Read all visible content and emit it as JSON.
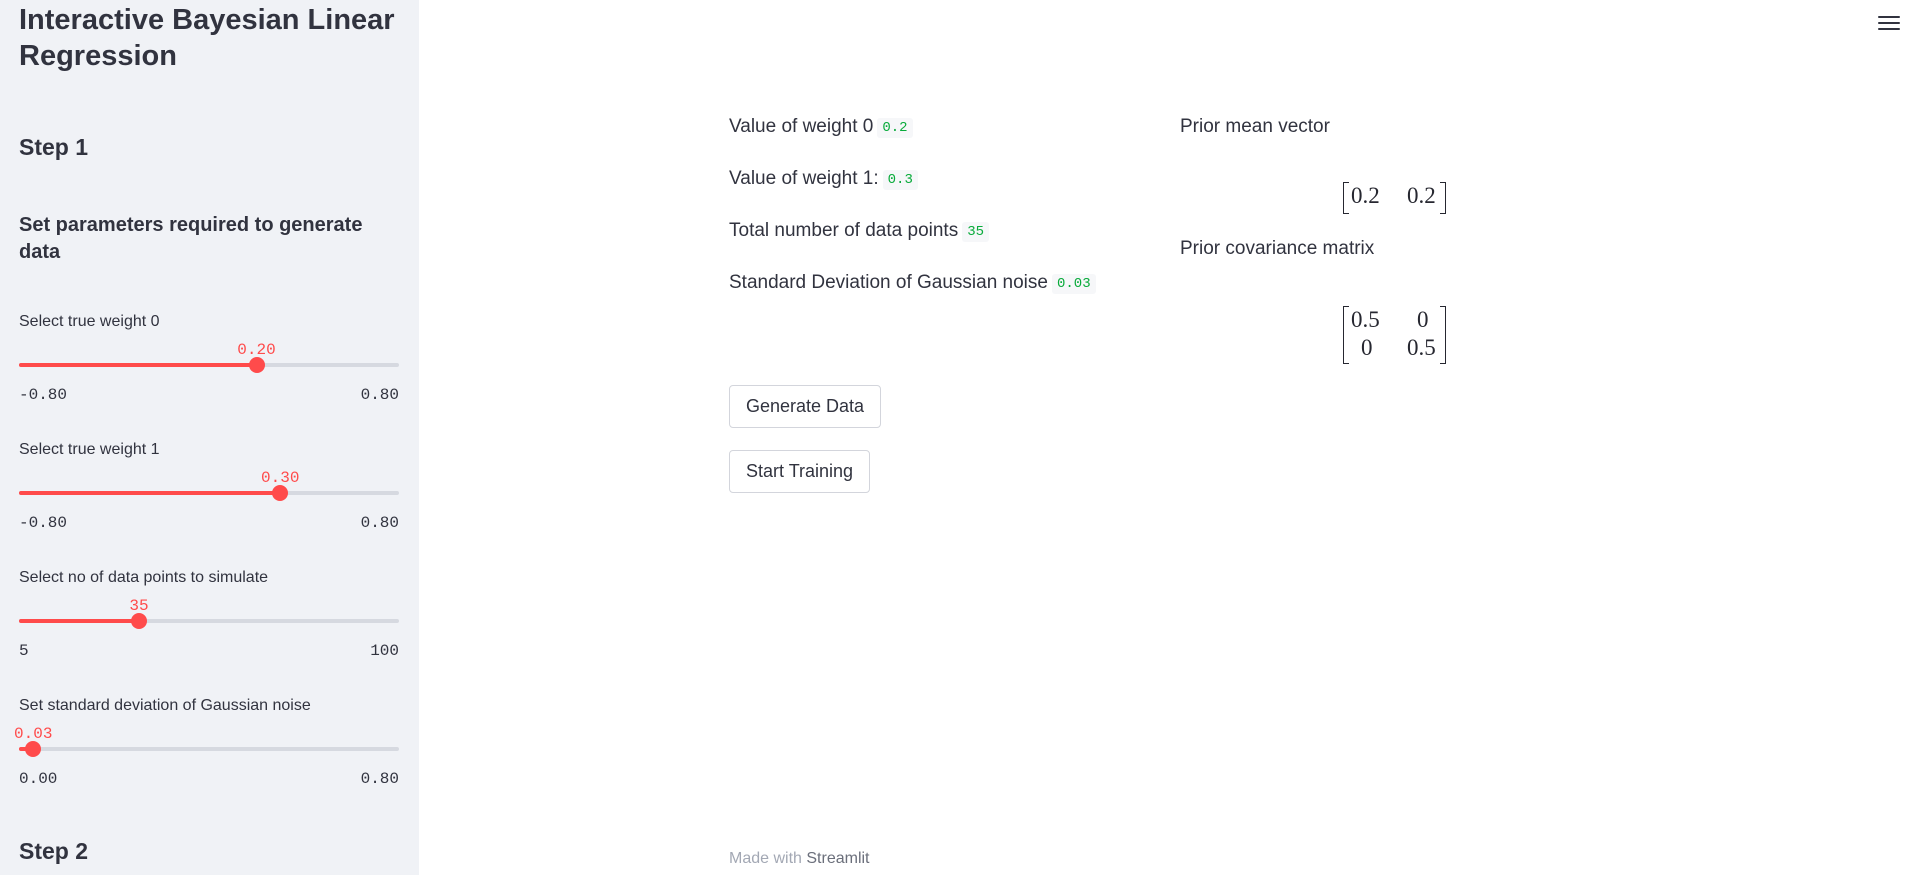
{
  "sidebar": {
    "title": "Interactive Bayesian Linear Regression",
    "step1": "Step 1",
    "params_heading": "Set parameters required to generate data",
    "step2": "Step 2",
    "sliders": [
      {
        "label": "Select true weight 0",
        "value": "0.20",
        "min": "-0.80",
        "max": "0.80",
        "fraction": 0.625
      },
      {
        "label": "Select true weight 1",
        "value": "0.30",
        "min": "-0.80",
        "max": "0.80",
        "fraction": 0.6875
      },
      {
        "label": "Select no of data points to simulate",
        "value": "35",
        "min": "5",
        "max": "100",
        "fraction": 0.3158
      },
      {
        "label": "Set standard deviation of Gaussian noise",
        "value": "0.03",
        "min": "0.00",
        "max": "0.80",
        "fraction": 0.0375
      }
    ]
  },
  "main": {
    "summary": [
      {
        "label": "Value of weight 0",
        "value": "0.2"
      },
      {
        "label": "Value of weight 1:",
        "value": "0.3"
      },
      {
        "label": "Total number of data points",
        "value": "35"
      },
      {
        "label": "Standard Deviation of Gaussian noise",
        "value": "0.03"
      }
    ],
    "prior_mean_label": "Prior mean vector",
    "prior_mean": [
      "0.2",
      "0.2"
    ],
    "prior_cov_label": "Prior covariance matrix",
    "prior_cov": [
      [
        "0.5",
        "0"
      ],
      [
        "0",
        "0.5"
      ]
    ],
    "generate_button": "Generate Data",
    "train_button": "Start Training",
    "footer_prefix": "Made with",
    "footer_brand": "Streamlit",
    "menu_icon": "hamburger-menu-icon"
  },
  "colors": {
    "accent": "#ff4b4b",
    "code_text": "#09ab3b",
    "sidebar_bg": "#f0f2f6"
  }
}
